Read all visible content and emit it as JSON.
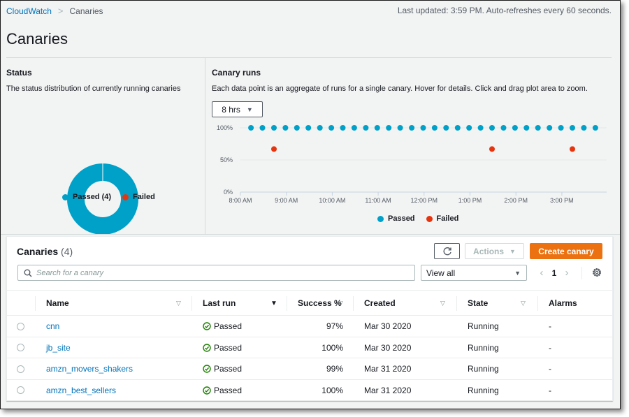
{
  "breadcrumb": {
    "root": "CloudWatch",
    "separator": ">",
    "current": "Canaries"
  },
  "last_updated": "Last updated: 3:59 PM. Auto-refreshes every 60 seconds.",
  "page_title": "Canaries",
  "status_panel": {
    "heading": "Status",
    "description": "The status distribution of currently running canaries",
    "legend": [
      {
        "label": "Passed (4)",
        "color": "#00a1c9"
      },
      {
        "label": "Failed",
        "color": "#e6350e"
      }
    ]
  },
  "runs_panel": {
    "heading": "Canary runs",
    "description": "Each data point is an aggregate of runs for a single canary. Hover for details. Click and drag plot area to zoom.",
    "range_selected": "8 hrs",
    "legend": [
      {
        "label": "Passed",
        "color": "#00a1c9"
      },
      {
        "label": "Failed",
        "color": "#e6350e"
      }
    ]
  },
  "colors": {
    "passed": "#00a1c9",
    "failed": "#e6350e",
    "link": "#0073bb",
    "primary_button": "#ec7211",
    "success_icon": "#1d8102"
  },
  "chart_data": [
    {
      "type": "pie",
      "title": "Status",
      "variant": "donut",
      "labels": [
        "Passed",
        "Failed"
      ],
      "values": [
        4,
        0
      ],
      "colors": [
        "#00a1c9",
        "#e6350e"
      ],
      "legend": "bottom"
    },
    {
      "type": "scatter",
      "title": "Canary runs",
      "xlabel": "",
      "ylabel": "",
      "x_ticks": [
        "8:00 AM",
        "9:00 AM",
        "10:00 AM",
        "11:00 AM",
        "12:00 PM",
        "1:00 PM",
        "2:00 PM",
        "3:00 PM"
      ],
      "y_ticks": [
        "0%",
        "50%",
        "100%"
      ],
      "xlim_hours": [
        8.0,
        16.2
      ],
      "ylim": [
        0,
        100
      ],
      "grid": true,
      "legend": "bottom",
      "series": [
        {
          "name": "Passed",
          "color": "#00a1c9",
          "x_hours": [
            8.23,
            8.48,
            8.73,
            8.98,
            9.23,
            9.48,
            9.73,
            9.98,
            10.23,
            10.48,
            10.73,
            10.98,
            11.23,
            11.48,
            11.73,
            11.98,
            12.23,
            12.48,
            12.73,
            12.98,
            13.23,
            13.48,
            13.73,
            13.98,
            14.23,
            14.48,
            14.73,
            14.98,
            15.23,
            15.48,
            15.73
          ],
          "y": [
            100,
            100,
            100,
            100,
            100,
            100,
            100,
            100,
            100,
            100,
            100,
            100,
            100,
            100,
            100,
            100,
            100,
            100,
            100,
            100,
            100,
            100,
            100,
            100,
            100,
            100,
            100,
            100,
            100,
            100,
            100
          ]
        },
        {
          "name": "Failed",
          "color": "#e6350e",
          "x_hours": [
            8.73,
            13.48,
            15.23
          ],
          "y": [
            67,
            67,
            67
          ]
        }
      ]
    }
  ],
  "table": {
    "title": "Canaries",
    "count": "(4)",
    "refresh_icon": "refresh-icon",
    "actions_label": "Actions",
    "create_label": "Create canary",
    "search_placeholder": "Search for a canary",
    "search_value": "",
    "view_filter": "View all",
    "page": "1",
    "columns": [
      {
        "label": "Name",
        "sort": "none"
      },
      {
        "label": "Last run",
        "sort": "active-desc"
      },
      {
        "label": "Success %",
        "sort": "none"
      },
      {
        "label": "Created",
        "sort": "none"
      },
      {
        "label": "State",
        "sort": "none"
      },
      {
        "label": "Alarms",
        "sort": ""
      }
    ],
    "rows": [
      {
        "name": "cnn",
        "last_run": "Passed",
        "success": "97%",
        "created": "Mar 30 2020",
        "state": "Running",
        "alarms": "-"
      },
      {
        "name": "jb_site",
        "last_run": "Passed",
        "success": "100%",
        "created": "Mar 30 2020",
        "state": "Running",
        "alarms": "-"
      },
      {
        "name": "amzn_movers_shakers",
        "last_run": "Passed",
        "success": "99%",
        "created": "Mar 31 2020",
        "state": "Running",
        "alarms": "-"
      },
      {
        "name": "amzn_best_sellers",
        "last_run": "Passed",
        "success": "100%",
        "created": "Mar 31 2020",
        "state": "Running",
        "alarms": "-"
      }
    ]
  }
}
